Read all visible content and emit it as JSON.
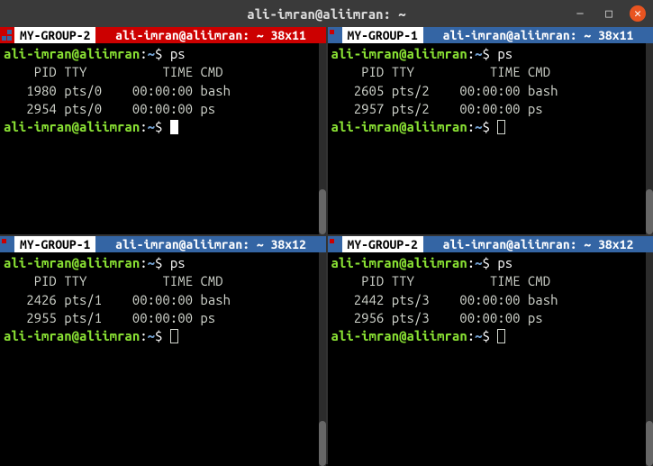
{
  "window": {
    "title": "ali-imran@aliimran: ~"
  },
  "panes": [
    {
      "group": "MY-GROUP-2",
      "title": "ali-imran@aliimran: ~ 38x11",
      "bar_color": "red-bar",
      "active": true,
      "prompt": {
        "user": "ali-imran",
        "host": "aliimran",
        "path": "~",
        "sep": "@",
        "colon": ":",
        "dollar": "$"
      },
      "cmd": "ps",
      "output_header": "    PID TTY          TIME CMD",
      "output_rows": [
        "   1980 pts/0    00:00:00 bash",
        "   2954 pts/0    00:00:00 ps"
      ]
    },
    {
      "group": "MY-GROUP-1",
      "title": "ali-imran@aliimran: ~ 38x11",
      "bar_color": "blue-bar",
      "active": false,
      "prompt": {
        "user": "ali-imran",
        "host": "aliimran",
        "path": "~",
        "sep": "@",
        "colon": ":",
        "dollar": "$"
      },
      "cmd": "ps",
      "output_header": "    PID TTY          TIME CMD",
      "output_rows": [
        "   2605 pts/2    00:00:00 bash",
        "   2957 pts/2    00:00:00 ps"
      ]
    },
    {
      "group": "MY-GROUP-1",
      "title": "ali-imran@aliimran: ~ 38x12",
      "bar_color": "blue-bar",
      "active": false,
      "prompt": {
        "user": "ali-imran",
        "host": "aliimran",
        "path": "~",
        "sep": "@",
        "colon": ":",
        "dollar": "$"
      },
      "cmd": "ps",
      "output_header": "    PID TTY          TIME CMD",
      "output_rows": [
        "   2426 pts/1    00:00:00 bash",
        "   2955 pts/1    00:00:00 ps"
      ]
    },
    {
      "group": "MY-GROUP-2",
      "title": "ali-imran@aliimran: ~ 38x12",
      "bar_color": "blue-bar",
      "active": false,
      "prompt": {
        "user": "ali-imran",
        "host": "aliimran",
        "path": "~",
        "sep": "@",
        "colon": ":",
        "dollar": "$"
      },
      "cmd": "ps",
      "output_header": "    PID TTY          TIME CMD",
      "output_rows": [
        "   2442 pts/3    00:00:00 bash",
        "   2956 pts/3    00:00:00 ps"
      ]
    }
  ]
}
